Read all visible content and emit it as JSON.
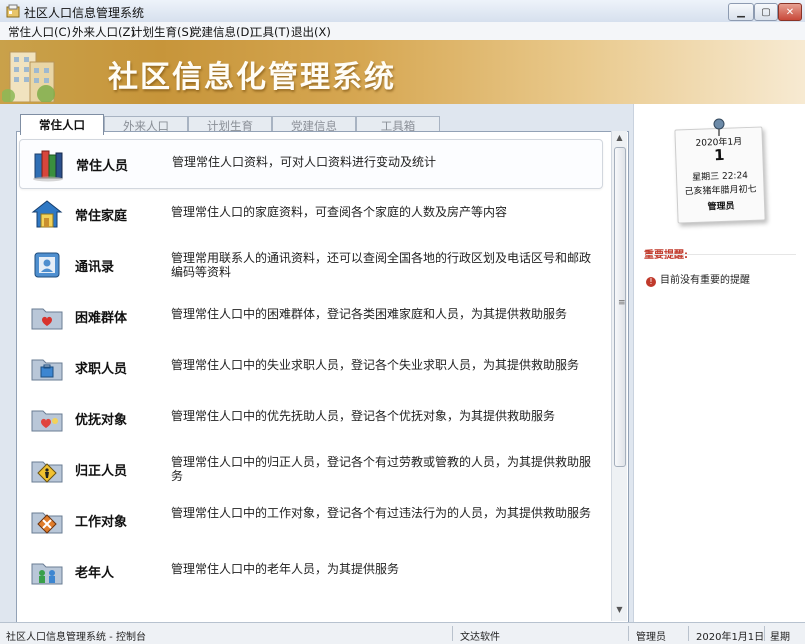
{
  "window": {
    "title": "社区人口信息管理系统"
  },
  "menu": [
    "常住人口(C)",
    "外来人口(Z)",
    "计划生育(S)",
    "党建信息(D)",
    "工具(T)",
    "退出(X)"
  ],
  "banner": {
    "title": "社区信息化管理系统"
  },
  "tabs": [
    "常住人口",
    "外来人口",
    "计划生育",
    "党建信息",
    "工具箱"
  ],
  "modules": [
    {
      "name": "常住人员",
      "desc": "管理常住人口资料，可对人口资料进行变动及统计",
      "icon": "books-icon"
    },
    {
      "name": "常住家庭",
      "desc": "管理常住人口的家庭资料，可查阅各个家庭的人数及房产等内容",
      "icon": "house-icon"
    },
    {
      "name": "通讯录",
      "desc": "管理常用联系人的通讯资料，还可以查阅全国各地的行政区划及电话区号和邮政编码等资料",
      "icon": "address-book-icon"
    },
    {
      "name": "困难群体",
      "desc": "管理常住人口中的困难群体，登记各类困难家庭和人员，为其提供救助服务",
      "icon": "heart-folder-icon"
    },
    {
      "name": "求职人员",
      "desc": "管理常住人口中的失业求职人员，登记各个失业求职人员，为其提供救助服务",
      "icon": "job-folder-icon"
    },
    {
      "name": "优抚对象",
      "desc": "管理常住人口中的优先抚助人员，登记各个优抚对象，为其提供救助服务",
      "icon": "care-folder-icon"
    },
    {
      "name": "归正人员",
      "desc": "管理常住人口中的归正人员，登记各个有过劳教或管教的人员，为其提供救助服务",
      "icon": "warning-sign-icon"
    },
    {
      "name": "工作对象",
      "desc": "管理常住人口中的工作对象，登记各个有过违法行为的人员，为其提供救助服务",
      "icon": "stop-sign-icon"
    },
    {
      "name": "老年人",
      "desc": "管理常住人口中的老年人员，为其提供服务",
      "icon": "elderly-icon"
    }
  ],
  "calendar": {
    "year_month": "2020年1月",
    "day": "1",
    "weekday_time": "星期三    22:24",
    "lunar": "己亥猪年腊月初七",
    "user": "管理员"
  },
  "reminders": {
    "title": "重要提醒:",
    "item": "目前没有重要的提醒"
  },
  "status": {
    "left": "社区人口信息管理系统 - 控制台",
    "company": "文达软件",
    "user": "管理员",
    "date": "2020年1月1日",
    "weekday": "星期"
  },
  "colors": {
    "accent_red": "#c0392b",
    "banner_gold": "#c7953a",
    "panel_border": "#93a2b6"
  }
}
